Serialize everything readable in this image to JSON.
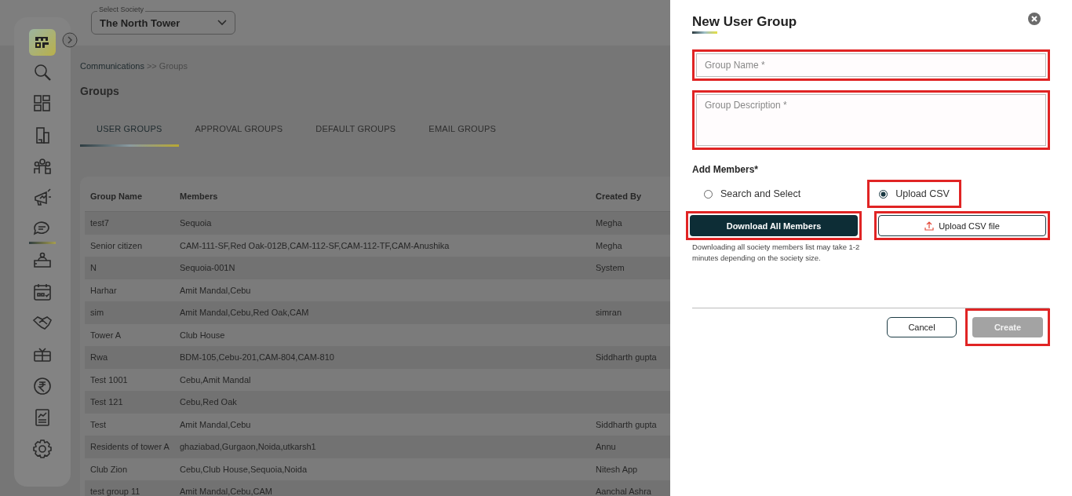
{
  "sidebar": {
    "items": [
      {
        "selected": false
      },
      {
        "selected": false
      },
      {
        "selected": false
      },
      {
        "selected": false
      },
      {
        "selected": false
      },
      {
        "selected": true
      },
      {
        "selected": false
      },
      {
        "selected": false
      },
      {
        "selected": false
      },
      {
        "selected": false
      },
      {
        "selected": false
      },
      {
        "selected": false
      },
      {
        "selected": false
      }
    ]
  },
  "society_select": {
    "label": "Select Society",
    "value": "The North Tower"
  },
  "breadcrumb": {
    "parent": "Communications",
    "current": ">> Groups"
  },
  "page_title": "Groups",
  "tabs": [
    {
      "label": "USER GROUPS",
      "selected": true
    },
    {
      "label": "APPROVAL GROUPS",
      "selected": false
    },
    {
      "label": "DEFAULT GROUPS",
      "selected": false
    },
    {
      "label": "EMAIL GROUPS",
      "selected": false
    }
  ],
  "table": {
    "columns": [
      "Group Name",
      "Members",
      "Created By"
    ],
    "rows": [
      [
        "test7",
        "Sequoia",
        "Megha"
      ],
      [
        "Senior citizen",
        "CAM-111-SF,Red Oak-012B,CAM-112-SF,CAM-112-TF,CAM-Anushika",
        "Megha"
      ],
      [
        "N",
        "Sequoia-001N",
        "System"
      ],
      [
        "Harhar",
        "Amit Mandal,Cebu",
        ""
      ],
      [
        "sim",
        "Amit Mandal,Cebu,Red Oak,CAM",
        "simran"
      ],
      [
        "Tower A",
        "Club House",
        ""
      ],
      [
        "Rwa",
        "BDM-105,Cebu-201,CAM-804,CAM-810",
        "Siddharth gupta"
      ],
      [
        "Test 1001",
        "Cebu,Amit Mandal",
        ""
      ],
      [
        "Test 121",
        "Cebu,Red Oak",
        ""
      ],
      [
        "Test",
        "Amit Mandal,Cebu",
        "Siddharth gupta"
      ],
      [
        "Residents of tower A",
        "ghaziabad,Gurgaon,Noida,utkarsh1",
        "Annu"
      ],
      [
        "Club Zion",
        "Cebu,Club House,Sequoia,Noida",
        "Nitesh App"
      ],
      [
        "test group 11",
        "Amit Mandal,Cebu,CAM",
        "Aanchal Ashra"
      ]
    ]
  },
  "drawer": {
    "title": "New User Group",
    "group_name": {
      "placeholder": "Group Name *",
      "highlighted": true
    },
    "group_description": {
      "placeholder": "Group Description *",
      "highlighted": true
    },
    "add_members_label": "Add Members*",
    "member_options": [
      {
        "label": "Search and Select",
        "selected": false,
        "highlighted": false
      },
      {
        "label": "Upload CSV",
        "selected": true,
        "highlighted": true
      }
    ],
    "download_button": {
      "label": "Download All Members",
      "highlighted": true
    },
    "upload_button": {
      "label": "Upload CSV file",
      "highlighted": true
    },
    "download_hint": "Downloading all society members list may take 1-2 minutes depending on the society size.",
    "cancel_button": {
      "label": "Cancel",
      "highlighted": false
    },
    "create_button": {
      "label": "Create",
      "disabled": true,
      "highlighted": true
    }
  }
}
